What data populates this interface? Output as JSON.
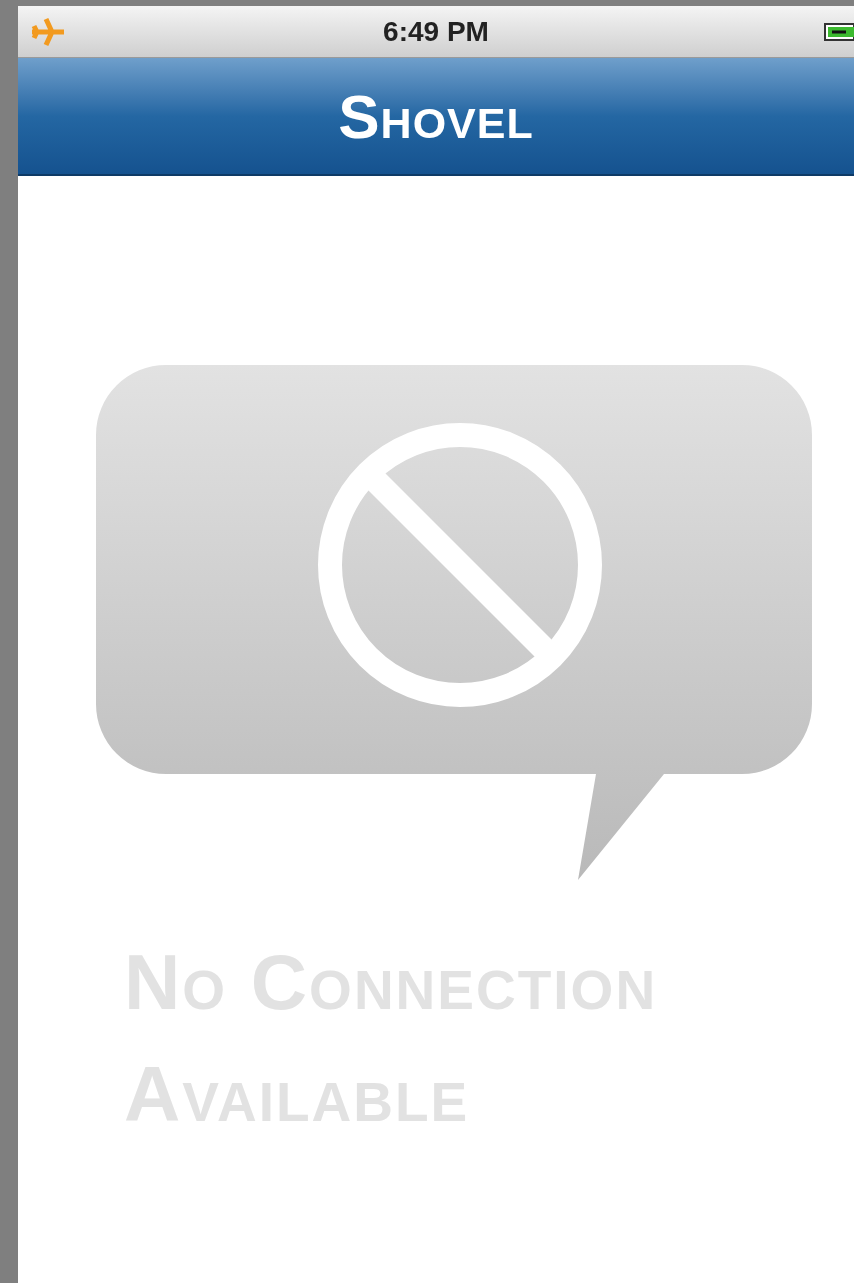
{
  "status_bar": {
    "time": "6:49 PM",
    "airplane_mode": true
  },
  "nav_bar": {
    "title": "Shovel"
  },
  "empty_state": {
    "message": "No Connection Available"
  }
}
